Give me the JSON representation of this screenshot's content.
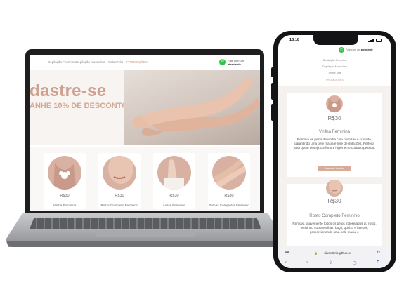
{
  "laptop": {
    "nav": {
      "items": [
        "Depilação Feminina",
        "Depilação Masculina",
        "Sobre Nós",
        "PROMOÇÕES"
      ],
      "whatsapp_text": "Fale com um",
      "whatsapp_bold": "atendente"
    },
    "hero": {
      "heading": "dastre-se",
      "subheading": "ANHE 10% DE DESCONTO"
    },
    "products": [
      {
        "price": "R$30",
        "name": "Virilha Feminina"
      },
      {
        "price": "R$30",
        "name": "Rosto Completo Feminino"
      },
      {
        "price": "R$30",
        "name": "Axilas Feminino"
      },
      {
        "price": "R$30",
        "name": "Pernas Completas Feminino"
      }
    ]
  },
  "phone": {
    "status_time": "18:18",
    "whatsapp_text": "Fale com um",
    "whatsapp_bold": "atendente",
    "nav": [
      "Depilação Feminina",
      "Depilação Masculina",
      "Sobre Nós",
      "PROMOÇÕES"
    ],
    "cards": [
      {
        "price": "R$30",
        "title": "Virilha Feminina",
        "description": "Remova os pelos da virilha com precisão e cuidado, garantindo uma pele macia e livre de irritações. Perfeita para quem deseja conforto e higiene no cuidado pessoal.",
        "button": "Marcar Horario"
      },
      {
        "price": "R$30",
        "title": "Rosto Completo Feminino",
        "description": "Remova suavemente todos os pelos indesejados do rosto, incluindo sobrancelhas, buço, queixo e laterais, proporcionando uma pele macia e"
      }
    ],
    "browser": {
      "aa": "AA",
      "url": "silvavit0ria.github.io",
      "lock": "🔒",
      "reload": "↻"
    },
    "toolbar_icons": [
      "‹",
      "›",
      "⇪",
      "▢",
      "⧉"
    ]
  }
}
